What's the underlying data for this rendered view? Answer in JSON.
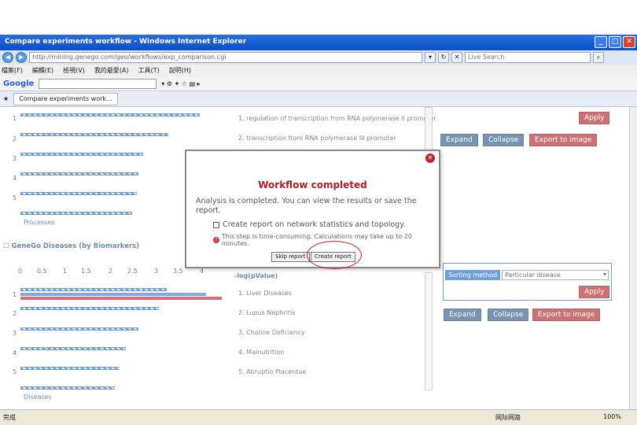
{
  "window": {
    "title": "Compare experiments workflow - Windows Internet Explorer"
  },
  "address": {
    "url": "http://mining.genego.com/geo/workflows/exp_comparison.cgi",
    "search_placeholder": "Live Search"
  },
  "tabs": {
    "active": "Compare experiments work..."
  },
  "processes": {
    "row_numbers": [
      "1",
      "2",
      "3",
      "4",
      "5"
    ],
    "labels": [
      "1. regulation of transcription from RNA polymerase II promoter",
      "2. transcription from RNA polymerase III promoter"
    ],
    "footer": "Processes"
  },
  "top_buttons": {
    "apply": "Apply",
    "expand": "Expand",
    "collapse": "Collapse",
    "export": "Export to image"
  },
  "diseases": {
    "section_title": "GeneGo Diseases (by Biomarkers)",
    "axis_title": "-log(pValue)",
    "ticks": [
      "0",
      "0.5",
      "1",
      "1.5",
      "2",
      "2.5",
      "3",
      "3.5",
      "4"
    ],
    "row_numbers": [
      "1",
      "2",
      "3",
      "4",
      "5"
    ],
    "labels": [
      "1. Liver Diseases",
      "2. Lupus Nephritis",
      "3. Choline Deficiency",
      "4. Malnutrition",
      "5. Abruptio Placentae"
    ],
    "footer": "Diseases"
  },
  "sorting": {
    "label": "Sorting method",
    "selected": "Particular disease",
    "apply": "Apply"
  },
  "bottom_buttons": {
    "expand": "Expand",
    "collapse": "Collapse",
    "export": "Export to image"
  },
  "modal": {
    "title": "Workflow completed",
    "message": "Analysis is completed. You can view the results or save the report.",
    "checkbox_label": "Create report on network statistics and topology.",
    "warning": "This step is time-consuming. Calculations may take up to 20 minutes.",
    "skip": "Skip report",
    "create": "Create report"
  },
  "status": {
    "left": "完成",
    "zone": "网际网路",
    "zoom": "100%"
  }
}
